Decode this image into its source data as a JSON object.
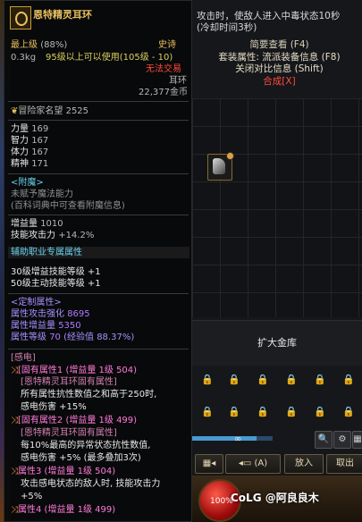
{
  "storage": {
    "desc_line1": "攻击时，使敌人进入中毒状态10秒",
    "desc_line2": "(冷却时间3秒)",
    "menu": [
      "简要查看 (F4)",
      "套装属性: 流派装备信息 (F8)",
      "关闭对比信息 (Shift)",
      "合成[X]"
    ],
    "expand_label": "扩大金库",
    "infinity": "∞",
    "progress": 0.8,
    "buttons": {
      "deposit": "放入",
      "withdraw": "取出",
      "key_a": "(A)"
    },
    "orb_label": "100%",
    "watermark": "CoLG @阿良良木"
  },
  "tooltip": {
    "item_name": "恩特精灵耳环",
    "max_level_label": "最上级",
    "max_level_pct": "(88%)",
    "rarity": "史诗",
    "weight": "0.3kg",
    "req_level": "95级以上可以使用(105级 - 10)",
    "trade": "无法交易",
    "slot_type": "耳环",
    "price": "22,377金币",
    "reputation_label": "冒险家名望",
    "reputation_value": "2525",
    "stats": [
      {
        "label": "力量",
        "value": "169"
      },
      {
        "label": "智力",
        "value": "167"
      },
      {
        "label": "体力",
        "value": "167"
      },
      {
        "label": "精神",
        "value": "171"
      }
    ],
    "enchant_header": "<附魔>",
    "enchant_line1": "未赋予魔法能力",
    "enchant_line2": "(百科词典中可查看附魔信息)",
    "buff_label": "增益量",
    "buff_value": "1010",
    "skill_atk_label": "技能攻击力",
    "skill_atk_value": "+14.2%",
    "support_header": "辅助职业专属属性",
    "support_line1": "30级增益技能等级 +1",
    "support_line2": "50级主动技能等级 +1",
    "custom_header": "<定制属性>",
    "custom_rows": [
      {
        "label": "属性攻击强化",
        "value": "8695"
      },
      {
        "label": "属性增益量",
        "value": "5350"
      }
    ],
    "custom_level_label": "属性等级",
    "custom_level_value": "70",
    "custom_level_note": "(经验值 88.37%)",
    "elec_header": "[感电]",
    "attrs": [
      {
        "title": "[固有属性1 (增益量 1级 504)",
        "src": "[恩特精灵耳环固有属性]",
        "lines": [
          "所有属性抗性数值之和高于250时,",
          "感电伤害 +15%"
        ]
      },
      {
        "title": "[固有属性2 (增益量 1级 499)",
        "src": "[恩特精灵耳环固有属性]",
        "lines": [
          "每10%最高的异常状态抗性数值,",
          "感电伤害 +5% (最多叠加3次)"
        ]
      },
      {
        "title": "属性3 (增益量 1级 504)",
        "src": "",
        "lines": [
          "攻击感电状态的敌人时, 技能攻击力",
          "+5%"
        ]
      },
      {
        "title": "属性4 (增益量 1级 499)",
        "src": "",
        "lines": []
      }
    ],
    "colors": {
      "name": "#e8c060",
      "epic": "#e8c060",
      "custom": "#b07aff",
      "red": "#ff4a3a"
    }
  }
}
